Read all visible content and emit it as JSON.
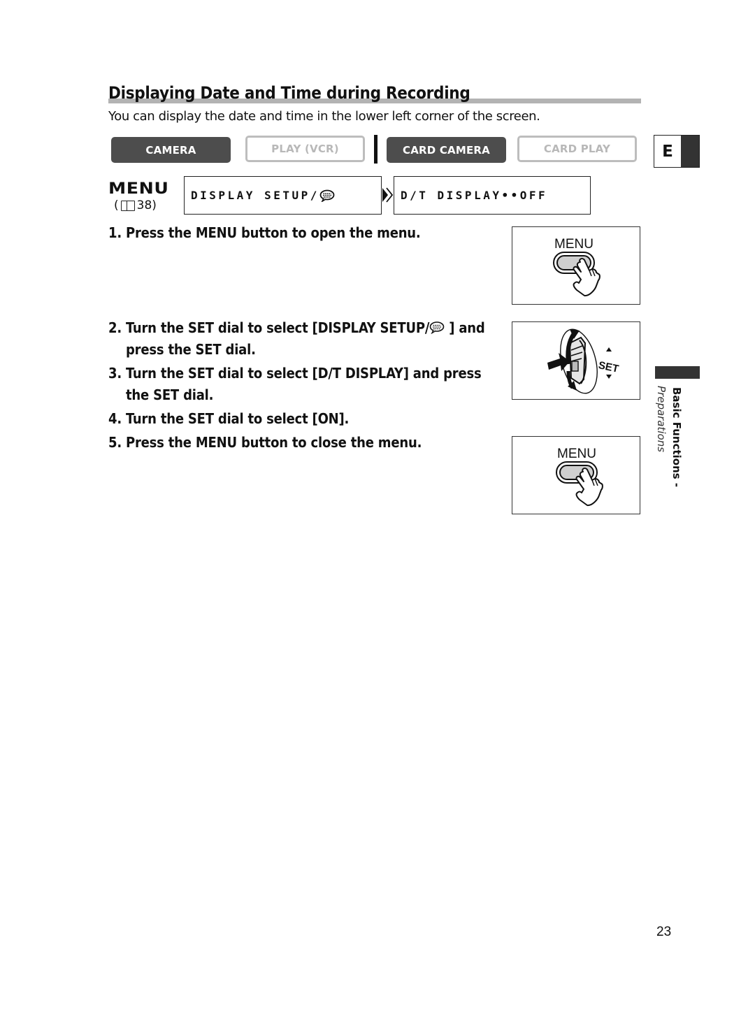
{
  "page": {
    "title": "Displaying Date and Time during Recording",
    "subtitle": "You can display the date and time in the lower left corner of the screen.",
    "page_number": "23"
  },
  "modes": [
    {
      "label": "CAMERA",
      "active": true
    },
    {
      "label": "PLAY (VCR)",
      "active": false
    },
    {
      "label": "CARD CAMERA",
      "active": true
    },
    {
      "label": "CARD PLAY",
      "active": false
    }
  ],
  "language_tab": {
    "letter": "E"
  },
  "menu_ref": {
    "label": "MENU",
    "open_paren": "(",
    "page_ref": "38)",
    "icon": "book-icon"
  },
  "menu_path": {
    "level1": "DISPLAY SETUP/",
    "level1_icon": "speech-bubble-icon",
    "arrow_icon": "double-chevron-right-icon",
    "level2": "D/T DISPLAY••OFF"
  },
  "steps": [
    {
      "num": "1.",
      "lines": [
        "Press the MENU button to open the menu."
      ]
    },
    {
      "num": "2.",
      "line1_pre": "Turn the SET dial to select [DISPLAY SETUP/",
      "line1_post": " ] and",
      "line2": "press the SET dial."
    },
    {
      "num": "3.",
      "lines": [
        "Turn the SET dial to select [D/T DISPLAY] and press",
        "the SET dial."
      ]
    },
    {
      "num": "4.",
      "lines": [
        "Turn the SET dial to select [ON]."
      ]
    },
    {
      "num": "5.",
      "lines": [
        "Press the MENU button to close the menu."
      ]
    }
  ],
  "figures": {
    "menu_button_1": {
      "label": "MENU"
    },
    "set_dial": {
      "label": "SET"
    },
    "menu_button_2": {
      "label": "MENU"
    }
  },
  "side_tab": {
    "section": "Basic Functions -",
    "subsection": "Preparations"
  }
}
